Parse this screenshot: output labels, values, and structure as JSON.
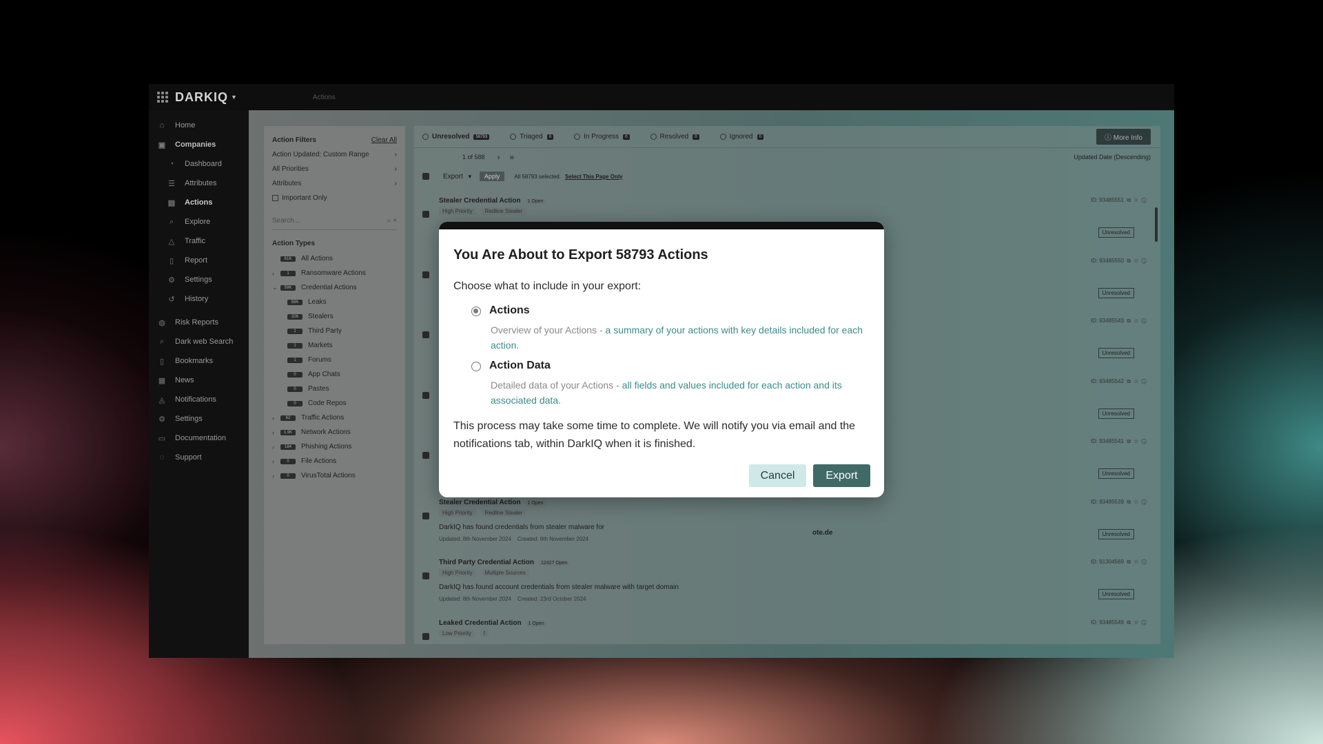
{
  "app": {
    "logo": "DARKIQ",
    "breadcrumb": "Actions"
  },
  "nav": {
    "items": [
      {
        "label": "Home",
        "icon": "home-icon",
        "glyph": "⌂",
        "type": "top"
      },
      {
        "label": "Companies",
        "icon": "companies-icon",
        "glyph": "▣",
        "type": "bold"
      },
      {
        "label": "Dashboard",
        "icon": "dashboard-icon",
        "glyph": "◔",
        "type": "sub"
      },
      {
        "label": "Attributes",
        "icon": "attributes-icon",
        "glyph": "☰",
        "type": "sub"
      },
      {
        "label": "Actions",
        "icon": "actions-icon",
        "glyph": "▤",
        "type": "sub-active"
      },
      {
        "label": "Explore",
        "icon": "explore-icon",
        "glyph": "⌕",
        "type": "sub"
      },
      {
        "label": "Traffic",
        "icon": "traffic-icon",
        "glyph": "△",
        "type": "sub"
      },
      {
        "label": "Report",
        "icon": "report-icon",
        "glyph": "▯",
        "type": "sub"
      },
      {
        "label": "Settings",
        "icon": "settings-icon",
        "glyph": "⚙",
        "type": "sub"
      },
      {
        "label": "History",
        "icon": "history-icon",
        "glyph": "↺",
        "type": "sub"
      },
      {
        "label": "Risk Reports",
        "icon": "risk-reports-icon",
        "glyph": "◍",
        "type": "top"
      },
      {
        "label": "Dark web Search",
        "icon": "search-icon",
        "glyph": "⌕",
        "type": "top"
      },
      {
        "label": "Bookmarks",
        "icon": "bookmark-icon",
        "glyph": "▯",
        "type": "top"
      },
      {
        "label": "News",
        "icon": "news-icon",
        "glyph": "▦",
        "type": "top"
      },
      {
        "label": "Notifications",
        "icon": "bell-icon",
        "glyph": "◬",
        "type": "top"
      },
      {
        "label": "Settings",
        "icon": "gear-icon",
        "glyph": "⚙",
        "type": "top"
      },
      {
        "label": "Documentation",
        "icon": "book-icon",
        "glyph": "▭",
        "type": "top"
      },
      {
        "label": "Support",
        "icon": "support-icon",
        "glyph": "◌",
        "type": "top"
      }
    ]
  },
  "filters": {
    "title": "Action Filters",
    "clear": "Clear All",
    "rows": [
      "Action Updated: Custom Range",
      "All Priorities",
      "Attributes"
    ],
    "important": "Important Only",
    "search_placeholder": "Search...",
    "types_title": "Action Types",
    "types": [
      {
        "label": "All Actions",
        "badge": "61K",
        "chev": "",
        "child": false
      },
      {
        "label": "Ransomware Actions",
        "badge": "1",
        "chev": "›",
        "child": false
      },
      {
        "label": "Credential Actions",
        "badge": "59K",
        "chev": "⌄",
        "child": false
      },
      {
        "label": "Leaks",
        "badge": "58K",
        "chev": "",
        "child": true
      },
      {
        "label": "Stealers",
        "badge": "326",
        "chev": "",
        "child": true
      },
      {
        "label": "Third Party",
        "badge": "1",
        "chev": "",
        "child": true
      },
      {
        "label": "Markets",
        "badge": "1",
        "chev": "",
        "child": true
      },
      {
        "label": "Forums",
        "badge": "1",
        "chev": "",
        "child": true
      },
      {
        "label": "App Chats",
        "badge": "0",
        "chev": "",
        "child": true
      },
      {
        "label": "Pastes",
        "badge": "0",
        "chev": "",
        "child": true
      },
      {
        "label": "Code Repos",
        "badge": "0",
        "chev": "",
        "child": true
      },
      {
        "label": "Traffic Actions",
        "badge": "62",
        "chev": "›",
        "child": false
      },
      {
        "label": "Network Actions",
        "badge": "1.9K",
        "chev": "›",
        "child": false
      },
      {
        "label": "Phishing Actions",
        "badge": "184",
        "chev": "›",
        "child": false
      },
      {
        "label": "File Actions",
        "badge": "0",
        "chev": "›",
        "child": false
      },
      {
        "label": "VirusTotal Actions",
        "badge": "0",
        "chev": "›",
        "child": false
      }
    ]
  },
  "tabs": [
    {
      "label": "Unresolved",
      "count": "58793"
    },
    {
      "label": "Triaged",
      "count": "0"
    },
    {
      "label": "In Progress",
      "count": "0"
    },
    {
      "label": "Resolved",
      "count": "0"
    },
    {
      "label": "Ignored",
      "count": "0"
    }
  ],
  "more_info": "More Info",
  "pager": {
    "text": "1 of 588",
    "sort": "Updated Date (Descending)"
  },
  "actionbar": {
    "export": "Export",
    "apply": "Apply",
    "selected": "All 58793 selected.",
    "select_page": "Select This Page Only"
  },
  "rows": [
    {
      "title": "Stealer Credential Action",
      "open": "1 Open",
      "priority": "High Priority",
      "source": "Redline Stealer",
      "desc": "",
      "updated": "",
      "created": "",
      "id": "ID: 93485551",
      "status": "Unresolved"
    },
    {
      "title": "",
      "open": "",
      "priority": "",
      "source": "",
      "desc": "",
      "updated": "",
      "created": "",
      "id": "ID: 93485550",
      "status": "Unresolved"
    },
    {
      "title": "",
      "open": "",
      "priority": "",
      "source": "",
      "desc": "",
      "updated": "",
      "created": "",
      "id": "ID: 93485543",
      "status": "Unresolved"
    },
    {
      "title": "",
      "open": "",
      "priority": "",
      "source": "",
      "desc": "",
      "updated": "",
      "created": "",
      "id": "ID: 93485542",
      "status": "Unresolved"
    },
    {
      "title": "",
      "open": "",
      "priority": "",
      "source": "",
      "desc": "",
      "updated": "",
      "created": "",
      "id": "ID: 93485541",
      "status": "Unresolved"
    },
    {
      "title": "Stealer Credential Action",
      "open": "1 Open",
      "priority": "High Priority",
      "source": "Redline Stealer",
      "desc": "DarkIQ has found credentials from stealer malware for",
      "updated": "Updated: 8th November 2024",
      "created": "Created: 8th November 2024",
      "id": "ID: 93485539",
      "status": "Unresolved"
    },
    {
      "title": "Third Party Credential Action",
      "open": "12427 Open",
      "priority": "High Priority",
      "source": "Multiple Sources",
      "desc": "DarkIQ has found account credentials from stealer malware with target domain",
      "updated": "Updated: 8th November 2024",
      "created": "Created: 23rd October 2024",
      "id": "ID: 91304569",
      "status": "Unresolved"
    },
    {
      "title": "Leaked Credential Action",
      "open": "1 Open",
      "priority": "Low Priority",
      "source": "f",
      "desc": "",
      "updated": "",
      "created": "",
      "id": "ID: 93485549",
      "status": ""
    }
  ],
  "partial_text": "ote.de",
  "modal": {
    "title": "You Are About to Export 58793 Actions",
    "subtitle": "Choose what to include in your export:",
    "option1_label": "Actions",
    "option1_desc_a": "Overview of your Actions - ",
    "option1_desc_b": "a summary of your actions with key details included for each action.",
    "option2_label": "Action Data",
    "option2_desc_a": "Detailed data of your Actions - ",
    "option2_desc_b": "all fields and values included for each action and its associated data.",
    "note": "This process may take some time to complete. We will notify you via email and the notifications tab, within DarkIQ when it is finished.",
    "cancel": "Cancel",
    "export": "Export"
  },
  "colors": {
    "accent": "#3f6a68",
    "accent_light": "#cfe9e8",
    "link_teal": "#3b8b8a"
  }
}
